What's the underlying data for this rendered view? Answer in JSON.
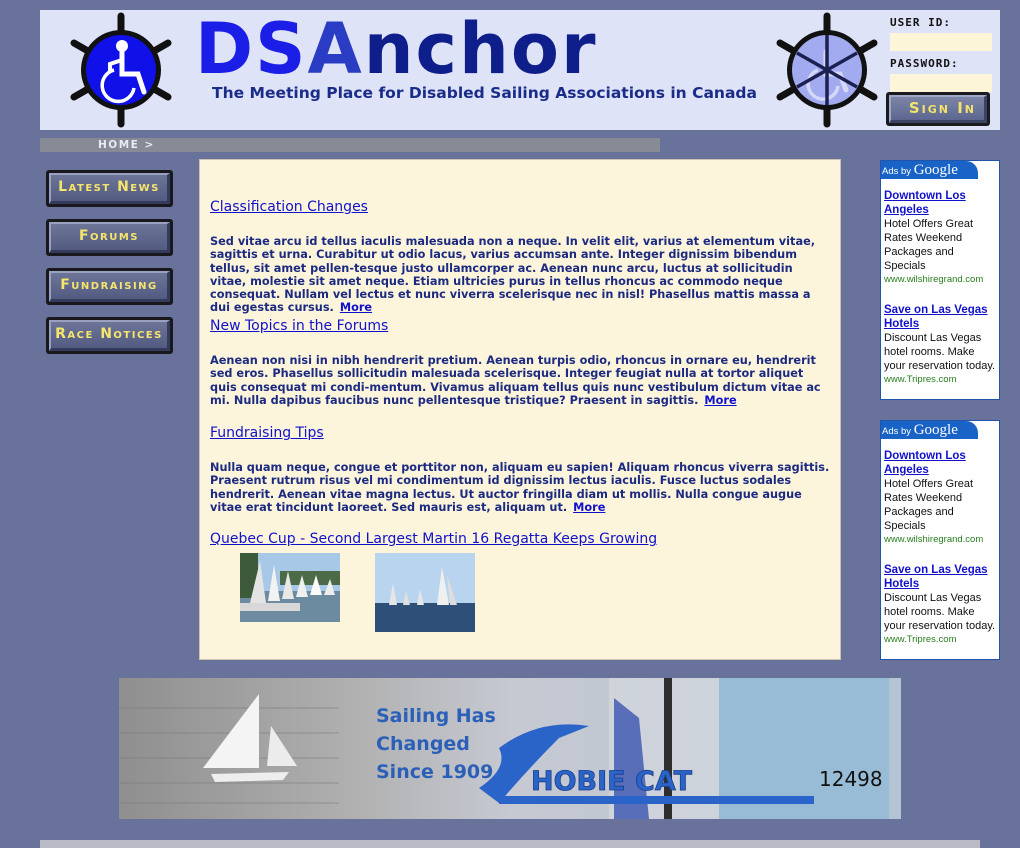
{
  "header": {
    "logo_ds": "DS",
    "logo_a": "A",
    "logo_rest": "nchor",
    "tagline": "The Meeting Place for Disabled Sailing Associations in Canada",
    "left_icon": "ships-wheel-wheelchair-icon",
    "right_icon": "ships-wheel-faded-wheelchair-icon"
  },
  "login": {
    "user_id_label": "USER ID:",
    "user_id_value": "",
    "password_label": "PASSWORD:",
    "password_value": "",
    "sign_in_label": "Sign In"
  },
  "breadcrumb": {
    "text": "HOME >"
  },
  "nav": {
    "items": [
      {
        "label": "Latest News"
      },
      {
        "label": "Forums"
      },
      {
        "label": "Fundraising"
      },
      {
        "label": "Race Notices"
      }
    ]
  },
  "articles": [
    {
      "title": "Classification Changes",
      "body": "Sed vitae arcu id tellus iaculis malesuada non a neque. In velit elit, varius at elementum vitae, sagittis et urna. Curabitur ut odio lacus, varius accumsan ante. Integer dignissim bibendum tellus, sit amet pellen-tesque justo ullamcorper ac. Aenean nunc arcu, luctus at sollicitudin vitae, molestie sit amet neque. Etiam ultricies purus in tellus rhoncus ac commodo neque consequat. Nullam vel lectus et nunc viverra scelerisque nec in nisl! Phasellus mattis massa a dui egestas cursus.",
      "more": "More"
    },
    {
      "title": "New Topics in the Forums",
      "body": "Aenean non nisi in nibh hendrerit pretium. Aenean turpis odio, rhoncus in ornare eu, hendrerit sed eros. Phasellus sollicitudin malesuada scelerisque. Integer feugiat nulla at tortor aliquet quis consequat mi condi-mentum. Vivamus aliquam tellus quis nunc vestibulum dictum vitae ac mi. Nulla dapibus faucibus nunc pellentesque tristique? Praesent in sagittis.",
      "more": "More"
    },
    {
      "title": "Fundraising Tips",
      "body": "Nulla quam neque, congue et porttitor non, aliquam eu sapien! Aliquam rhoncus viverra sagittis. Praesent rutrum risus vel mi condimentum id dignissim lectus iaculis. Fusce luctus sodales hendrerit. Aenean vitae magna lectus. Ut auctor fringilla diam ut mollis. Nulla congue augue vitae erat tincidunt laoreet. Sed mauris est, aliquam ut.",
      "more": "More"
    },
    {
      "title": "Quebec Cup - Second Largest Martin 16 Regatta Keeps Growing"
    }
  ],
  "photos": [
    {
      "alt": "sailboats-docked-photo"
    },
    {
      "alt": "sailboats-racing-photo"
    }
  ],
  "ads": [
    {
      "header_prefix": "Ads by ",
      "header_brand": "Google",
      "items": [
        {
          "title": "Downtown Los Angeles",
          "desc": "Hotel Offers Great Rates Weekend Packages and Specials",
          "url": "www.wilshiregrand.com"
        },
        {
          "title": "Save on Las Vegas Hotels",
          "desc": "Discount Las Vegas hotel rooms. Make your reservation today.",
          "url": "www.Tripres.com"
        }
      ]
    },
    {
      "header_prefix": "Ads by ",
      "header_brand": "Google",
      "items": [
        {
          "title": "Downtown Los Angeles",
          "desc": "Hotel Offers Great Rates Weekend Packages and Specials",
          "url": "www.wilshiregrand.com"
        },
        {
          "title": "Save on Las Vegas Hotels",
          "desc": "Discount Las Vegas hotel rooms. Make your reservation today.",
          "url": "www.Tripres.com"
        }
      ]
    }
  ],
  "banner": {
    "headline_1": "Sailing Has",
    "headline_2": "Changed",
    "headline_3": "Since 1909",
    "brand": "HOBIE CAT",
    "sail_number": "12498"
  },
  "colors": {
    "page_bg": "#68729a",
    "header_bg": "#dfe3f7",
    "content_bg": "#fcf5dc",
    "nav_text": "#f5e56c",
    "link": "#1111cc",
    "body_text": "#1c2a82"
  }
}
